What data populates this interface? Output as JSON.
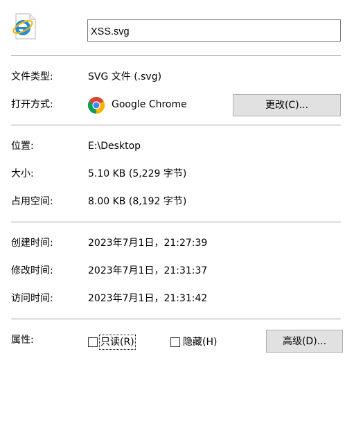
{
  "header": {
    "file_icon": "internet-explorer-icon",
    "file_name": "XSS.svg"
  },
  "type_section": {
    "file_type_label": "文件类型:",
    "file_type_value": "SVG 文件 (.svg)",
    "opens_with_label": "打开方式:",
    "opens_with_icon": "chrome-icon",
    "opens_with_app": "Google Chrome",
    "change_button": "更改(C)..."
  },
  "location_section": {
    "location_label": "位置:",
    "location_value": "E:\\Desktop",
    "size_label": "大小:",
    "size_value": "5.10 KB (5,229 字节)",
    "size_on_disk_label": "占用空间:",
    "size_on_disk_value": "8.00 KB (8,192 字节)"
  },
  "time_section": {
    "created_label": "创建时间:",
    "created_value": "2023年7月1日，21:27:39",
    "modified_label": "修改时间:",
    "modified_value": "2023年7月1日，21:31:37",
    "accessed_label": "访问时间:",
    "accessed_value": "2023年7月1日，21:31:42"
  },
  "attributes_section": {
    "attributes_label": "属性:",
    "readonly_label": "只读(R)",
    "readonly_checked": false,
    "hidden_label": "隐藏(H)",
    "hidden_checked": false,
    "advanced_button": "高级(D)..."
  },
  "colors": {
    "divider": "#a0a0a0",
    "button_bg": "#e1e1e1",
    "button_border": "#adadad",
    "chrome_red": "#db4437",
    "chrome_yellow": "#f4b400",
    "chrome_green": "#0f9d58",
    "chrome_blue": "#4285f4",
    "ie_blue": "#1f8ad6",
    "ie_ring": "#f2b705"
  }
}
